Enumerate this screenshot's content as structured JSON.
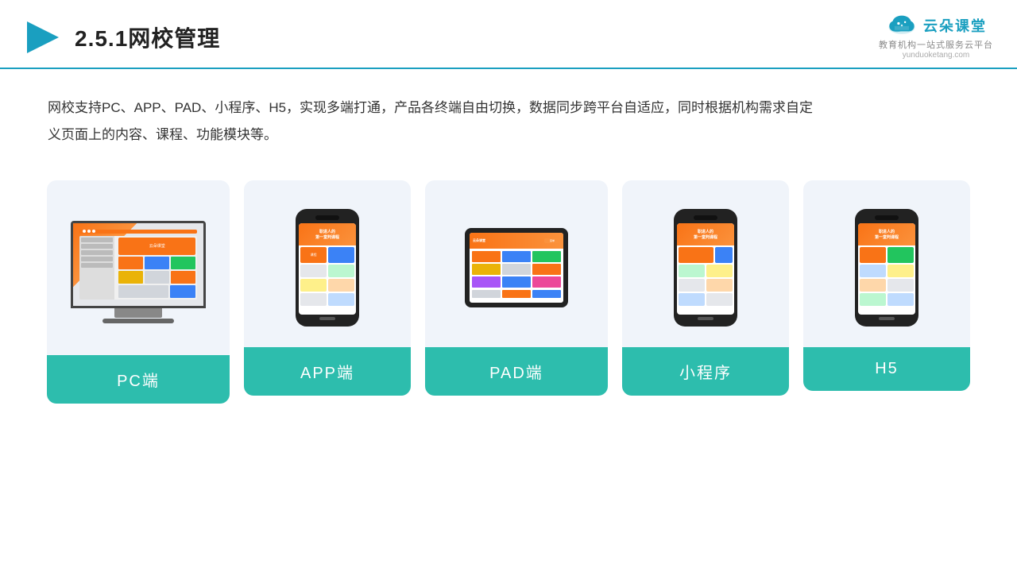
{
  "header": {
    "title": "2.5.1网校管理",
    "logo_main": "云朵课堂",
    "logo_url": "yunduoketang.com",
    "logo_tagline": "教育机构一站式服务云平台"
  },
  "description": "网校支持PC、APP、PAD、小程序、H5，实现多端打通，产品各终端自由切换，数据同步跨平台自适应，同时根据机构需求自定义页面上的内容、课程、功能模块等。",
  "cards": [
    {
      "id": "pc",
      "label": "PC端"
    },
    {
      "id": "app",
      "label": "APP端"
    },
    {
      "id": "pad",
      "label": "PAD端"
    },
    {
      "id": "miniprogram",
      "label": "小程序"
    },
    {
      "id": "h5",
      "label": "H5"
    }
  ]
}
